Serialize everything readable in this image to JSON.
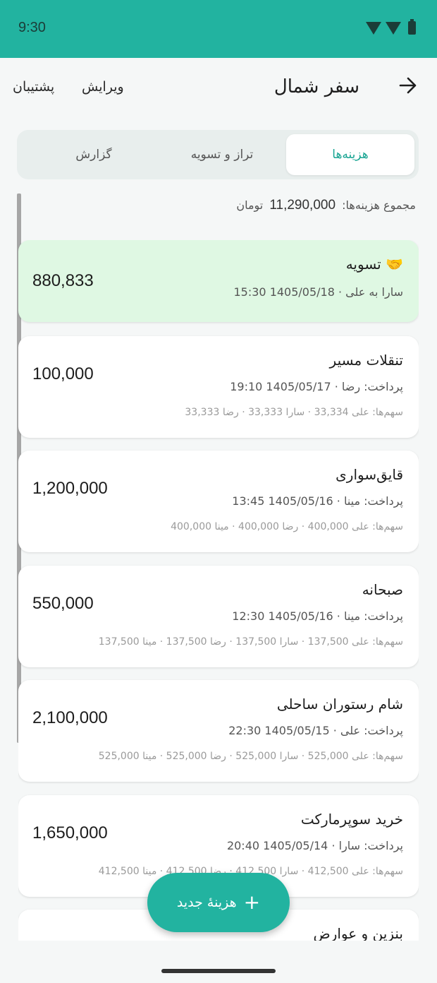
{
  "status": {
    "time": "9:30"
  },
  "header": {
    "title": "سفر شمال",
    "edit_label": "ویرایش",
    "support_label": "پشتیبان"
  },
  "tabs": [
    {
      "label": "هزینه‌ها",
      "active": true
    },
    {
      "label": "تراز و تسویه",
      "active": false
    },
    {
      "label": "گزارش",
      "active": false
    }
  ],
  "summary": {
    "label": "مجموع هزینه‌ها:",
    "value": "11,290,000",
    "unit": "تومان"
  },
  "settlement": {
    "icon": "handshake-icon",
    "title": "تسویه",
    "meta": "سارا به علی · 1405/05/18 15:30",
    "amount": "880,833"
  },
  "expenses": [
    {
      "title": "تنقلات مسیر",
      "meta": "پرداخت: رضا · 1405/05/17 19:10",
      "shares": "سهم‌ها: علی 33,334 · سارا 33,333 · رضا 33,333",
      "amount": "100,000"
    },
    {
      "title": "قایق‌سواری",
      "meta": "پرداخت: مینا · 1405/05/16 13:45",
      "shares": "سهم‌ها: علی 400,000 · رضا 400,000 · مینا 400,000",
      "amount": "1,200,000"
    },
    {
      "title": "صبحانه",
      "meta": "پرداخت: مینا · 1405/05/16 12:30",
      "shares": "سهم‌ها: علی 137,500 · سارا 137,500 · رضا 137,500 · مینا 137,500",
      "amount": "550,000"
    },
    {
      "title": "شام رستوران ساحلی",
      "meta": "پرداخت: علی · 1405/05/15 22:30",
      "shares": "سهم‌ها: علی 525,000 · سارا 525,000 · رضا 525,000 · مینا 525,000",
      "amount": "2,100,000"
    },
    {
      "title": "خرید سوپرمارکت",
      "meta": "پرداخت: سارا · 1405/05/14 20:40",
      "shares": "سهم‌ها: علی 412,500 · سارا 412,500 · رضا 412,500 · مینا 412,500",
      "amount": "1,650,000"
    },
    {
      "title": "بنزین و عوارض",
      "meta": "",
      "shares": "",
      "amount": ""
    }
  ],
  "fab": {
    "label": "هزینهٔ جدید"
  },
  "colors": {
    "accent": "#22b3a0",
    "settle_bg": "#dff8e3"
  }
}
